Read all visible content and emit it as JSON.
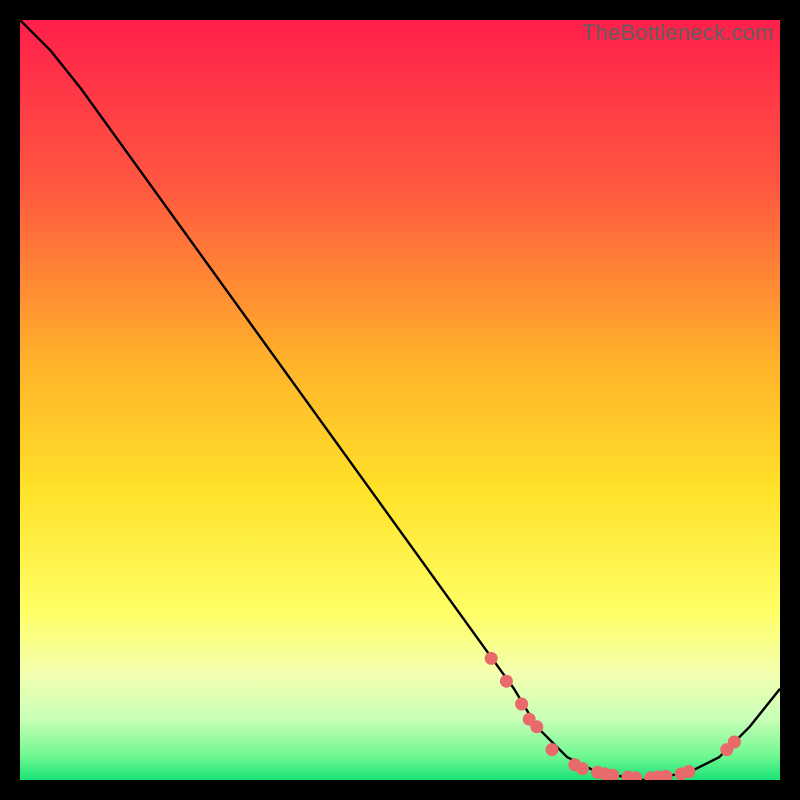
{
  "watermark": "TheBottleneck.com",
  "chart_data": {
    "type": "line",
    "title": "",
    "xlabel": "",
    "ylabel": "",
    "xlim": [
      0,
      100
    ],
    "ylim": [
      0,
      100
    ],
    "gradient_stops": [
      {
        "offset": 0,
        "color": "#ff1f4b"
      },
      {
        "offset": 22,
        "color": "#ff5840"
      },
      {
        "offset": 45,
        "color": "#ffb22a"
      },
      {
        "offset": 62,
        "color": "#ffe22a"
      },
      {
        "offset": 78,
        "color": "#ffff66"
      },
      {
        "offset": 86,
        "color": "#f4ffb0"
      },
      {
        "offset": 92,
        "color": "#c8ffb7"
      },
      {
        "offset": 97,
        "color": "#6cf78f"
      },
      {
        "offset": 100,
        "color": "#19e278"
      }
    ],
    "curve": [
      {
        "x": 0,
        "y": 100
      },
      {
        "x": 4,
        "y": 96
      },
      {
        "x": 8,
        "y": 91
      },
      {
        "x": 65,
        "y": 12
      },
      {
        "x": 68,
        "y": 7
      },
      {
        "x": 72,
        "y": 3
      },
      {
        "x": 76,
        "y": 1
      },
      {
        "x": 82,
        "y": 0
      },
      {
        "x": 88,
        "y": 1
      },
      {
        "x": 92,
        "y": 3
      },
      {
        "x": 96,
        "y": 7
      },
      {
        "x": 100,
        "y": 12
      }
    ],
    "markers": [
      {
        "x": 62,
        "y": 16
      },
      {
        "x": 64,
        "y": 13
      },
      {
        "x": 66,
        "y": 10
      },
      {
        "x": 67,
        "y": 8
      },
      {
        "x": 68,
        "y": 7
      },
      {
        "x": 70,
        "y": 4
      },
      {
        "x": 73,
        "y": 2
      },
      {
        "x": 74,
        "y": 1.5
      },
      {
        "x": 76,
        "y": 1
      },
      {
        "x": 77,
        "y": 0.8
      },
      {
        "x": 78,
        "y": 0.6
      },
      {
        "x": 80,
        "y": 0.4
      },
      {
        "x": 81,
        "y": 0.3
      },
      {
        "x": 83,
        "y": 0.3
      },
      {
        "x": 84,
        "y": 0.4
      },
      {
        "x": 85,
        "y": 0.5
      },
      {
        "x": 87,
        "y": 0.8
      },
      {
        "x": 88,
        "y": 1.1
      },
      {
        "x": 93,
        "y": 4
      },
      {
        "x": 94,
        "y": 5
      }
    ],
    "marker_color": "#e86a6a",
    "curve_color": "#000000"
  }
}
